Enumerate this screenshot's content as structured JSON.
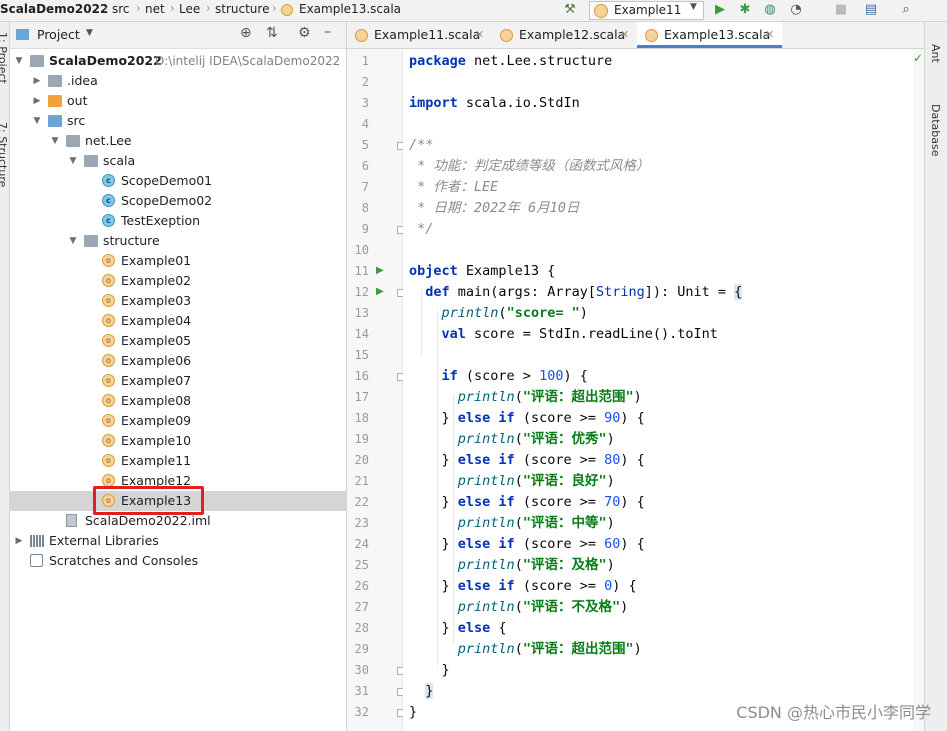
{
  "breadcrumb": [
    "ScalaDemo2022",
    "src",
    "net",
    "Lee",
    "structure",
    "Example13.scala"
  ],
  "run_config": "Example11",
  "toolbar_icons": [
    "hammer-icon",
    "run-icon",
    "debug-icon",
    "coverage-icon",
    "profile-icon",
    "stop-icon",
    "project-structure-icon",
    "search-everywhere-icon"
  ],
  "left_stripe": {
    "project": "1: Project",
    "structure": "7: Structure"
  },
  "right_stripe": {
    "ant": "Ant",
    "database": "Database"
  },
  "project_panel": {
    "title": "Project",
    "tree": [
      {
        "label": "ScalaDemo2022",
        "hint": "D:\\intelij IDEA\\ScalaDemo2022",
        "depth": 0,
        "arrow": "▼",
        "icon": "module"
      },
      {
        "label": ".idea",
        "depth": 1,
        "arrow": "▶",
        "icon": "folder"
      },
      {
        "label": "out",
        "depth": 1,
        "arrow": "▶",
        "icon": "folder-orange"
      },
      {
        "label": "src",
        "depth": 1,
        "arrow": "▼",
        "icon": "folder-blue"
      },
      {
        "label": "net.Lee",
        "depth": 2,
        "arrow": "▼",
        "icon": "package"
      },
      {
        "label": "scala",
        "depth": 3,
        "arrow": "▼",
        "icon": "package"
      },
      {
        "label": "ScopeDemo01",
        "depth": 4,
        "arrow": "",
        "icon": "class"
      },
      {
        "label": "ScopeDemo02",
        "depth": 4,
        "arrow": "",
        "icon": "class"
      },
      {
        "label": "TestExeption",
        "depth": 4,
        "arrow": "",
        "icon": "class"
      },
      {
        "label": "structure",
        "depth": 3,
        "arrow": "▼",
        "icon": "package"
      },
      {
        "label": "Example01",
        "depth": 4,
        "arrow": "",
        "icon": "object"
      },
      {
        "label": "Example02",
        "depth": 4,
        "arrow": "",
        "icon": "object"
      },
      {
        "label": "Example03",
        "depth": 4,
        "arrow": "",
        "icon": "object"
      },
      {
        "label": "Example04",
        "depth": 4,
        "arrow": "",
        "icon": "object"
      },
      {
        "label": "Example05",
        "depth": 4,
        "arrow": "",
        "icon": "object"
      },
      {
        "label": "Example06",
        "depth": 4,
        "arrow": "",
        "icon": "object"
      },
      {
        "label": "Example07",
        "depth": 4,
        "arrow": "",
        "icon": "object"
      },
      {
        "label": "Example08",
        "depth": 4,
        "arrow": "",
        "icon": "object"
      },
      {
        "label": "Example09",
        "depth": 4,
        "arrow": "",
        "icon": "object"
      },
      {
        "label": "Example10",
        "depth": 4,
        "arrow": "",
        "icon": "object"
      },
      {
        "label": "Example11",
        "depth": 4,
        "arrow": "",
        "icon": "object"
      },
      {
        "label": "Example12",
        "depth": 4,
        "arrow": "",
        "icon": "object"
      },
      {
        "label": "Example13",
        "depth": 4,
        "arrow": "",
        "icon": "object",
        "selected": true
      },
      {
        "label": "ScalaDemo2022.iml",
        "depth": 2,
        "arrow": "",
        "icon": "file"
      },
      {
        "label": "External Libraries",
        "depth": 0,
        "arrow": "▶",
        "icon": "library"
      },
      {
        "label": "Scratches and Consoles",
        "depth": 0,
        "arrow": "",
        "icon": "scratch"
      }
    ]
  },
  "tabs": [
    {
      "label": "Example11.scala",
      "active": false
    },
    {
      "label": "Example12.scala",
      "active": false
    },
    {
      "label": "Example13.scala",
      "active": true
    }
  ],
  "editor": {
    "current_line": 31,
    "lines": [
      [
        [
          "kw",
          "package"
        ],
        [
          "pln",
          " net.Lee.structure"
        ]
      ],
      [],
      [
        [
          "kw",
          "import"
        ],
        [
          "pln",
          " scala.io.StdIn"
        ]
      ],
      [],
      [
        [
          "cmt",
          "/**"
        ]
      ],
      [
        [
          "cmt",
          " * 功能：判定成绩等级（函数式风格）"
        ]
      ],
      [
        [
          "cmt",
          " * 作者：LEE"
        ]
      ],
      [
        [
          "cmt",
          " * 日期：2022年 6月10日"
        ]
      ],
      [
        [
          "cmt",
          " */"
        ]
      ],
      [],
      [
        [
          "kw",
          "object"
        ],
        [
          "pln",
          " Example13 {"
        ]
      ],
      [
        [
          "pln",
          "  "
        ],
        [
          "kw",
          "def"
        ],
        [
          "pln",
          " main(args: Array["
        ],
        [
          "ty",
          "String"
        ],
        [
          "pln",
          "]): Unit = "
        ],
        [
          "brace",
          "{"
        ]
      ],
      [
        [
          "pln",
          "    "
        ],
        [
          "fn",
          "println"
        ],
        [
          "pln",
          "("
        ],
        [
          "str",
          "\"score= \""
        ],
        [
          "pln",
          ")"
        ]
      ],
      [
        [
          "pln",
          "    "
        ],
        [
          "kw",
          "val"
        ],
        [
          "pln",
          " score = StdIn.readLine().toInt"
        ]
      ],
      [],
      [
        [
          "pln",
          "    "
        ],
        [
          "kw",
          "if"
        ],
        [
          "pln",
          " (score > "
        ],
        [
          "num",
          "100"
        ],
        [
          "pln",
          ") {"
        ]
      ],
      [
        [
          "pln",
          "      "
        ],
        [
          "fn",
          "println"
        ],
        [
          "pln",
          "("
        ],
        [
          "str",
          "\"评语：超出范围\""
        ],
        [
          "pln",
          ")"
        ]
      ],
      [
        [
          "pln",
          "    } "
        ],
        [
          "kw",
          "else if"
        ],
        [
          "pln",
          " (score >= "
        ],
        [
          "num",
          "90"
        ],
        [
          "pln",
          ") {"
        ]
      ],
      [
        [
          "pln",
          "      "
        ],
        [
          "fn",
          "println"
        ],
        [
          "pln",
          "("
        ],
        [
          "str",
          "\"评语：优秀\""
        ],
        [
          "pln",
          ")"
        ]
      ],
      [
        [
          "pln",
          "    } "
        ],
        [
          "kw",
          "else if"
        ],
        [
          "pln",
          " (score >= "
        ],
        [
          "num",
          "80"
        ],
        [
          "pln",
          ") {"
        ]
      ],
      [
        [
          "pln",
          "      "
        ],
        [
          "fn",
          "println"
        ],
        [
          "pln",
          "("
        ],
        [
          "str",
          "\"评语：良好\""
        ],
        [
          "pln",
          ")"
        ]
      ],
      [
        [
          "pln",
          "    } "
        ],
        [
          "kw",
          "else if"
        ],
        [
          "pln",
          " (score >= "
        ],
        [
          "num",
          "70"
        ],
        [
          "pln",
          ") {"
        ]
      ],
      [
        [
          "pln",
          "      "
        ],
        [
          "fn",
          "println"
        ],
        [
          "pln",
          "("
        ],
        [
          "str",
          "\"评语：中等\""
        ],
        [
          "pln",
          ")"
        ]
      ],
      [
        [
          "pln",
          "    } "
        ],
        [
          "kw",
          "else if"
        ],
        [
          "pln",
          " (score >= "
        ],
        [
          "num",
          "60"
        ],
        [
          "pln",
          ") {"
        ]
      ],
      [
        [
          "pln",
          "      "
        ],
        [
          "fn",
          "println"
        ],
        [
          "pln",
          "("
        ],
        [
          "str",
          "\"评语：及格\""
        ],
        [
          "pln",
          ")"
        ]
      ],
      [
        [
          "pln",
          "    } "
        ],
        [
          "kw",
          "else if"
        ],
        [
          "pln",
          " (score >= "
        ],
        [
          "num",
          "0"
        ],
        [
          "pln",
          ") {"
        ]
      ],
      [
        [
          "pln",
          "      "
        ],
        [
          "fn",
          "println"
        ],
        [
          "pln",
          "("
        ],
        [
          "str",
          "\"评语：不及格\""
        ],
        [
          "pln",
          ")"
        ]
      ],
      [
        [
          "pln",
          "    } "
        ],
        [
          "kw",
          "else"
        ],
        [
          "pln",
          " {"
        ]
      ],
      [
        [
          "pln",
          "      "
        ],
        [
          "fn",
          "println"
        ],
        [
          "pln",
          "("
        ],
        [
          "str",
          "\"评语：超出范围\""
        ],
        [
          "pln",
          ")"
        ]
      ],
      [
        [
          "pln",
          "    }"
        ]
      ],
      [
        [
          "pln",
          "  "
        ],
        [
          "brace",
          "}"
        ]
      ],
      [
        [
          "pln",
          "}"
        ]
      ]
    ],
    "run_markers": [
      11,
      12
    ],
    "fold_markers": [
      5,
      9,
      12,
      16,
      30,
      31,
      32
    ]
  },
  "watermark": "CSDN @热心市民小李同学",
  "colors": {
    "selection_box": "#e02020",
    "active_tab_underline": "#4083c9",
    "current_line": "#fefae5"
  }
}
